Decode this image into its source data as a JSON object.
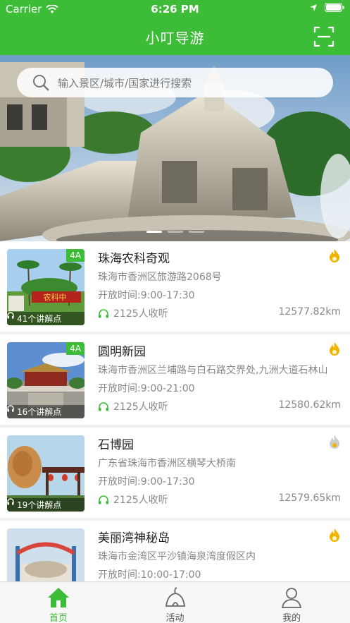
{
  "status_bar": {
    "carrier": "Carrier",
    "time": "6:26 PM"
  },
  "nav": {
    "title": "小叮导游"
  },
  "search": {
    "placeholder": "输入景区/城市/国家进行搜索"
  },
  "spots": [
    {
      "name": "珠海农科奇观",
      "address": "珠海市香洲区旅游路2068号",
      "hours": "开放时间:9:00-17:30",
      "listeners": "2125人收听",
      "distance": "12577.82km",
      "points": "41个讲解点",
      "level": "4A",
      "sign_text": "农科中"
    },
    {
      "name": "圆明新园",
      "address": "珠海市香洲区兰埔路与白石路交界处,九洲大道石林山",
      "hours": "开放时间:9:00-21:00",
      "listeners": "2125人收听",
      "distance": "12580.62km",
      "points": "16个讲解点",
      "level": "4A"
    },
    {
      "name": "石博园",
      "address": "广东省珠海市香洲区横琴大桥南",
      "hours": "开放时间:9:00-17:30",
      "listeners": "2125人收听",
      "distance": "12579.65km",
      "points": "19个讲解点",
      "level": ""
    },
    {
      "name": "美丽湾神秘岛",
      "address": "珠海市金湾区平沙镇海泉湾度假区内",
      "hours": "开放时间:10:00-17:00",
      "listeners": "",
      "distance": "",
      "points": "",
      "level": ""
    }
  ],
  "tabs": [
    {
      "label": "首页",
      "icon": "home-icon",
      "active": true
    },
    {
      "label": "活动",
      "icon": "tent-icon",
      "active": false
    },
    {
      "label": "我的",
      "icon": "person-icon",
      "active": false
    }
  ],
  "colors": {
    "brand": "#3dbd37",
    "hot": "#f0b400",
    "hot_dim": "#cccccc"
  }
}
